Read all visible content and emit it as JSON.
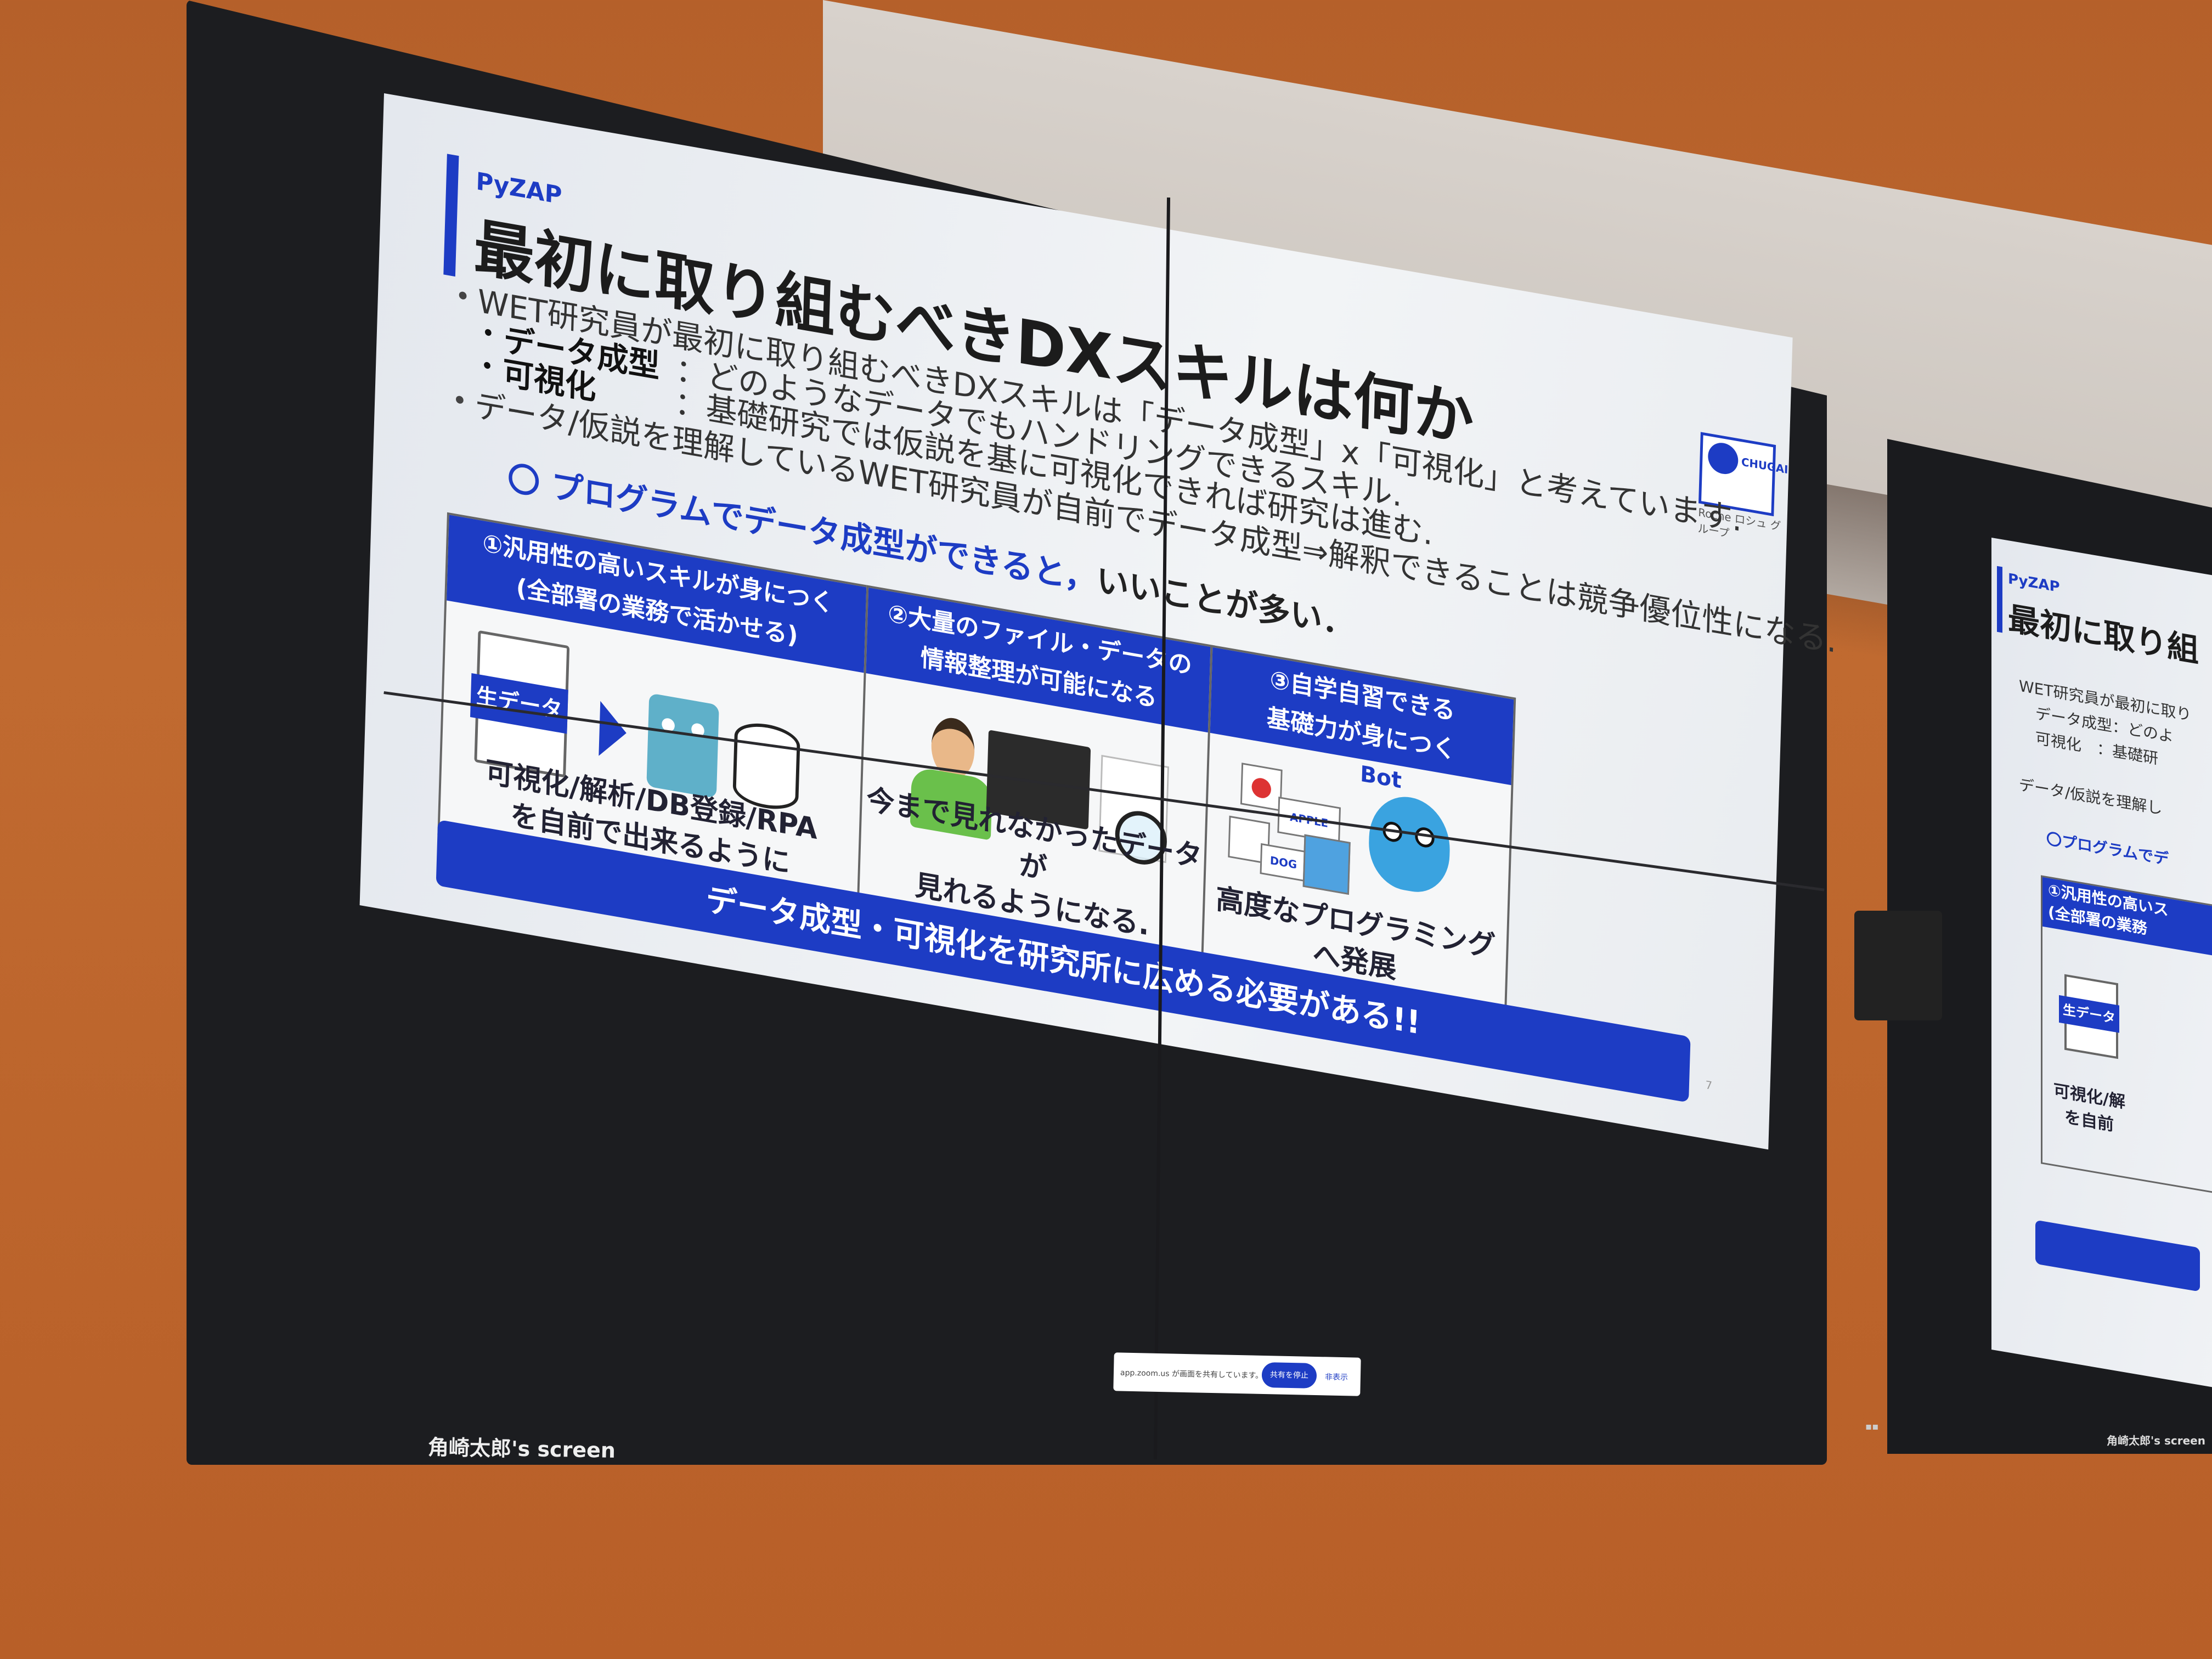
{
  "slide": {
    "brand": "PyZAP",
    "title": "最初に取り組むべきDXスキルは何か",
    "logo_text": "CHUGAI",
    "logo_sub": "Roche ロシュ グループ",
    "bullets": {
      "b1": "WET研究員が最初に取り組むべきDXスキルは「データ成型」x「可視化」と考えています.",
      "b1a_label": "データ成型",
      "b1a_text": "：どのようなデータでもハンドリングできるスキル.",
      "b1b_label": "可視化",
      "b1b_text": "：基礎研究では仮説を基に可視化できれば研究は進む.",
      "b2": "データ/仮説を理解しているWET研究員が自前でデータ成型⇒解釈できることは競争優位性になる."
    },
    "highlight_mark": "〇 プログラムでデータ成型ができると，",
    "highlight_rest": "いいことが多い．",
    "panels": [
      {
        "head_line1": "①汎用性の高いスキルが身につく",
        "head_line2": "(全部署の業務で活かせる)",
        "doc_label": "生データ",
        "caption_line1": "可視化/解析/DB登録/RPA",
        "caption_line2": "を自前で出来るように"
      },
      {
        "head_line1": "②大量のファイル・データの",
        "head_line2": "情報整理が可能になる",
        "caption_line1": "今まで見れなかったデータが",
        "caption_line2": "見れるようになる."
      },
      {
        "head_line1": "③自学自習できる",
        "head_line2": "基礎力が身につく",
        "bot_label": "Bot",
        "card_apple": "APPLE",
        "card_dog": "DOG",
        "caption_line1": "高度なプログラミングへ発展",
        "caption_line2": ""
      }
    ],
    "banner": "データ成型・可視化を研究所に広める必要がある!!",
    "page_number": "7"
  },
  "toolbar": {
    "text": "app.zoom.us が画面を共有しています。",
    "share_button": "共有を停止",
    "hide_link": "非表示"
  },
  "screen_label": "角崎太郎's screen",
  "screen_label_2": "角崎太郎's screen",
  "second_slide": {
    "brand": "PyZAP",
    "title": "最初に取り組",
    "line1": "WET研究員が最初に取り",
    "line2": "データ成型：どのよ",
    "line3": "可視化　：基礎研",
    "line4": "データ/仮説を理解し",
    "line5": "〇プログラムでデ",
    "panel_head": "①汎用性の高いス",
    "panel_sub": "(全部署の業務",
    "doc_label": "生データ",
    "caption1": "可視化/解",
    "caption2": "を自前"
  },
  "colors": {
    "accent": "#1d3cc4",
    "wall": "#b8602a",
    "bezel": "#1c1d20"
  }
}
